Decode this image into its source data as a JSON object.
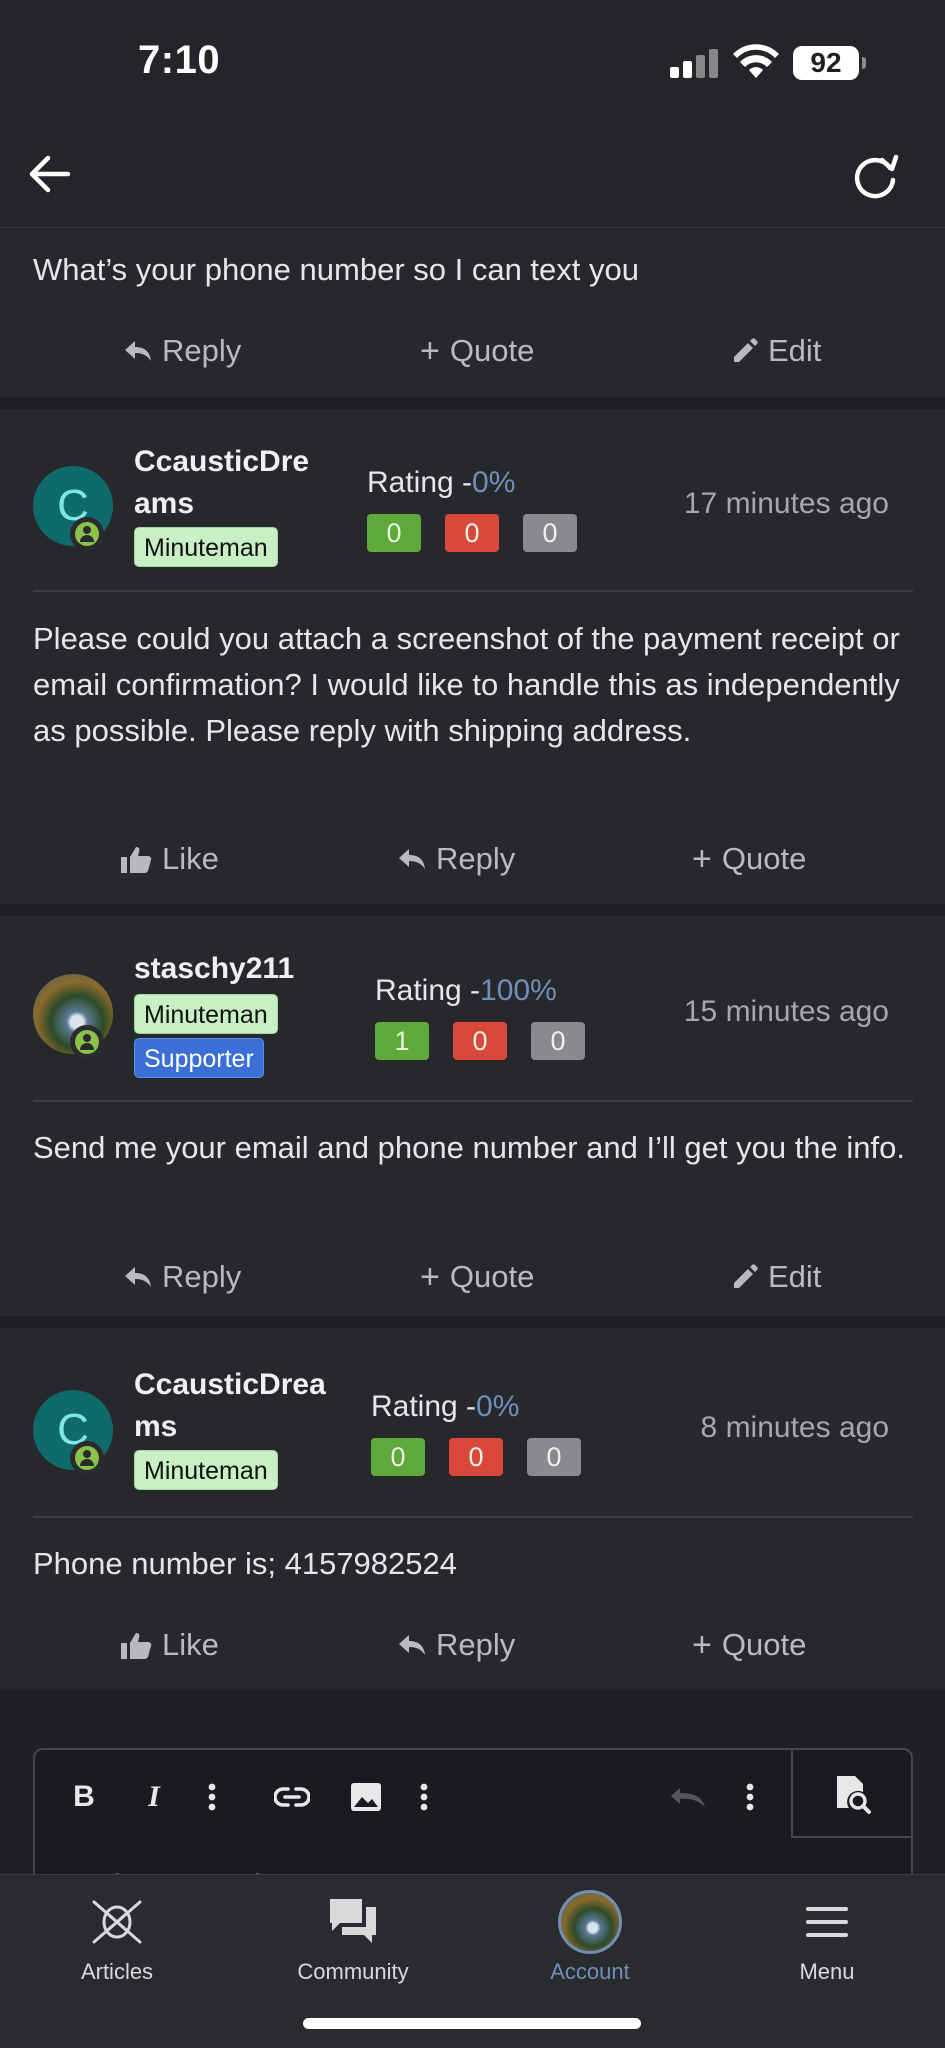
{
  "status": {
    "time": "7:10",
    "battery": "92"
  },
  "nav": {
    "back": "back",
    "refresh": "refresh"
  },
  "first_post": {
    "text": "What’s your phone number so I can text you",
    "actions": {
      "reply": "Reply",
      "quote": "Quote",
      "edit": "Edit"
    }
  },
  "posts": [
    {
      "username_line1": "CcausticDre",
      "username_line2": "ams",
      "avatar_letter": "C",
      "badges": [
        "Minuteman"
      ],
      "rating_label": "Rating -",
      "rating_pct": "0%",
      "counts": [
        "0",
        "0",
        "0"
      ],
      "ago": "17 minutes ago",
      "text": "Please could you attach a screenshot of the payment receipt or email confirmation? I would like to handle this as independently as possible. Please reply with shipping address.",
      "actions": {
        "like": "Like",
        "reply": "Reply",
        "quote": "Quote"
      }
    },
    {
      "username_line1": "staschy211",
      "badges": [
        "Minuteman",
        "Supporter"
      ],
      "rating_label": "Rating -",
      "rating_pct": "100%",
      "counts": [
        "1",
        "0",
        "0"
      ],
      "ago": "15 minutes ago",
      "text": "Send me your email and phone number and I’ll get you the info.",
      "actions": {
        "reply": "Reply",
        "quote": "Quote",
        "edit": "Edit"
      }
    },
    {
      "username_line1": "CcausticDrea",
      "username_line2": "ms",
      "avatar_letter": "C",
      "badges": [
        "Minuteman"
      ],
      "rating_label": "Rating -",
      "rating_pct": "0%",
      "counts": [
        "0",
        "0",
        "0"
      ],
      "ago": "8 minutes ago",
      "text": "Phone number is; 4157982524",
      "actions": {
        "like": "Like",
        "reply": "Reply",
        "quote": "Quote"
      }
    }
  ],
  "editor": {
    "placeholder": "Write your reply..."
  },
  "tabs": [
    {
      "label": "Articles",
      "icon": "articles-icon"
    },
    {
      "label": "Community",
      "icon": "chat-bubbles-icon"
    },
    {
      "label": "Account",
      "icon": "avatar"
    },
    {
      "label": "Menu",
      "icon": "hamburger-icon"
    }
  ],
  "colors": {
    "accent": "#6f8fb8",
    "like_green": "#5fa83a",
    "dislike_red": "#d9483b",
    "neutral": "#8a8a8e"
  }
}
